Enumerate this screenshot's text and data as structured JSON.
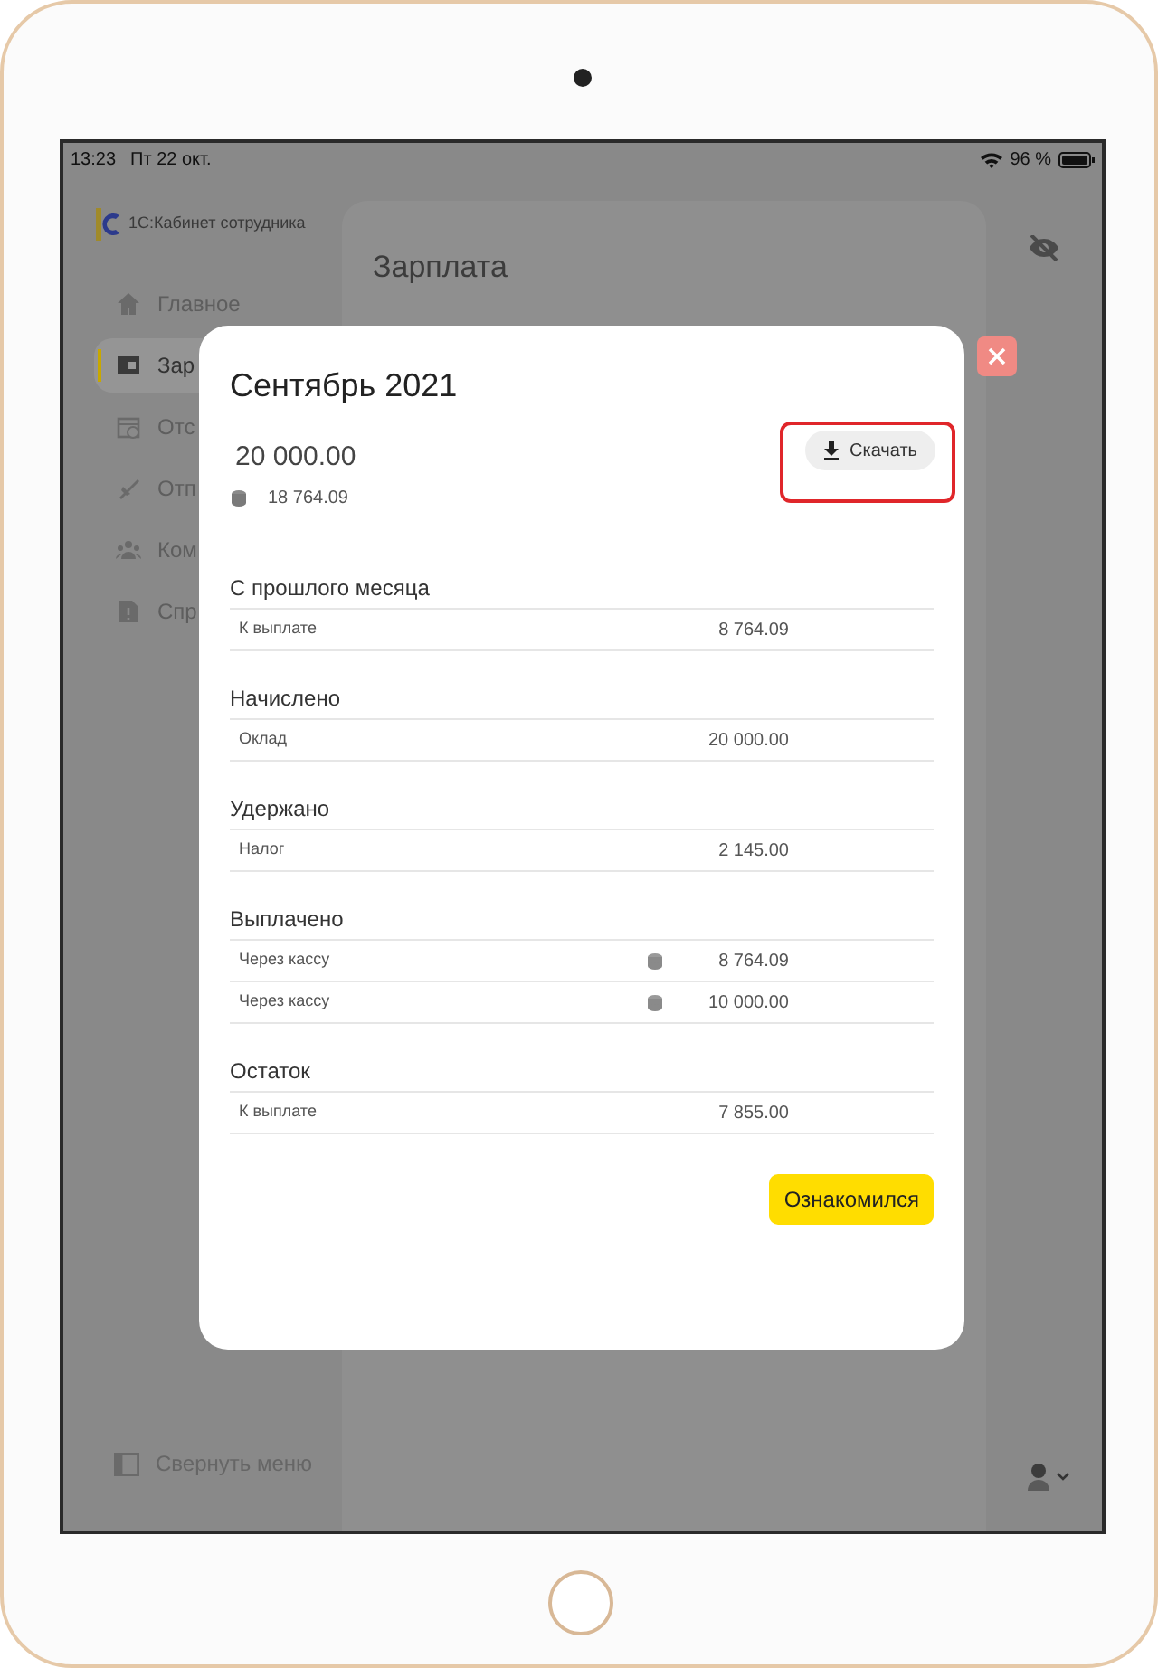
{
  "status_bar": {
    "time": "13:23",
    "date": "Пт 22 окт.",
    "battery": "96 %"
  },
  "sidebar": {
    "app_title": "1С:Кабинет сотрудника",
    "items": [
      {
        "kind": "home",
        "label": "Главное",
        "selected": false
      },
      {
        "kind": "wallet",
        "label": "Зар",
        "selected": true
      },
      {
        "kind": "calendar",
        "label": "Отс",
        "selected": false
      },
      {
        "kind": "plane",
        "label": "Отп",
        "selected": false
      },
      {
        "kind": "people",
        "label": "Ком",
        "selected": false
      },
      {
        "kind": "doc",
        "label": "Спр",
        "selected": false
      }
    ],
    "collapse": "Свернуть меню"
  },
  "page": {
    "title": "Зарплата"
  },
  "modal": {
    "title": "Сентябрь 2021",
    "amount": "20 000.00",
    "paid": "18 764.09",
    "download": "Скачать",
    "sections": [
      {
        "title": "С прошлого месяца",
        "rows": [
          {
            "label": "К выплате",
            "value": "8 764.09",
            "cash": false
          }
        ]
      },
      {
        "title": "Начислено",
        "rows": [
          {
            "label": "Оклад",
            "value": "20 000.00",
            "cash": false
          }
        ]
      },
      {
        "title": "Удержано",
        "rows": [
          {
            "label": "Налог",
            "value": "2 145.00",
            "cash": false
          }
        ]
      },
      {
        "title": "Выплачено",
        "rows": [
          {
            "label": "Через кассу",
            "value": "8 764.09",
            "cash": true
          },
          {
            "label": "Через кассу",
            "value": "10 000.00",
            "cash": true
          }
        ]
      },
      {
        "title": "Остаток",
        "rows": [
          {
            "label": "К выплате",
            "value": "7 855.00",
            "cash": false
          }
        ]
      }
    ],
    "confirm": "Ознакомился"
  }
}
